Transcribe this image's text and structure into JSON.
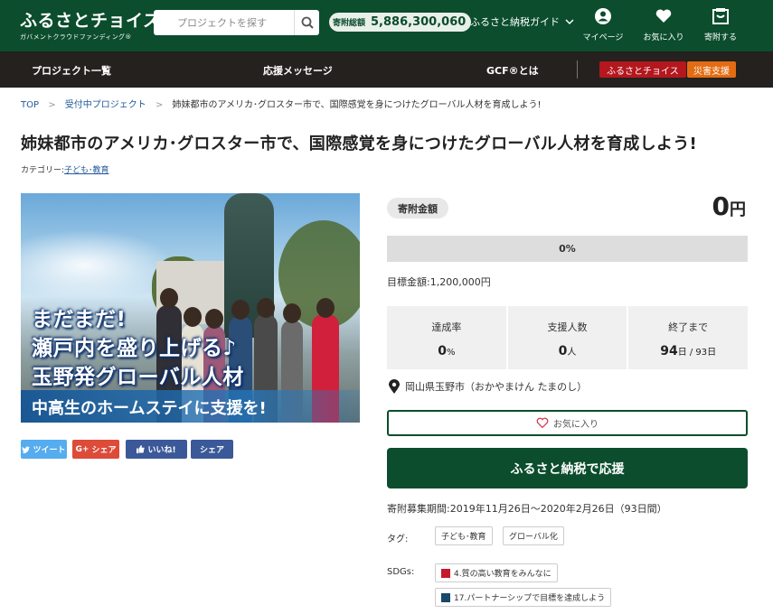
{
  "header": {
    "logo_main": "ふるさとチョイス",
    "logo_sub": "ガバメントクラウドファンディング®",
    "search_placeholder": "プロジェクトを探す",
    "total_label": "寄附総額",
    "total_value": "5,886,300,060",
    "guide_label": "ふるさと納税ガイド",
    "icons": [
      {
        "name": "mypage-icon",
        "label": "マイページ"
      },
      {
        "name": "heart-icon",
        "label": "お気に入り"
      },
      {
        "name": "gift-icon",
        "label": "寄附する"
      }
    ]
  },
  "nav": {
    "items": [
      "プロジェクト一覧",
      "応援メッセージ",
      "GCF®とは"
    ],
    "tag_red": "ふるさとチョイス",
    "tag_orange": "災害支援"
  },
  "breadcrumb": {
    "items": [
      "TOP",
      "受付中プロジェクト"
    ],
    "current": "姉妹都市のアメリカ･グロスター市で、国際感覚を身につけたグローバル人材を育成しよう!"
  },
  "project": {
    "title": "姉妹都市のアメリカ･グロスター市で、国際感覚を身につけたグローバル人材を育成しよう!",
    "category_label": "カテゴリー:",
    "category": "子ども･教育",
    "hero_lines": [
      "まだまだ!",
      "瀬戸内を盛り上げる♪",
      "玉野発グローバル人材"
    ],
    "hero_bottom": "中高生のホームステイに支援を!"
  },
  "share": {
    "tweet": "ツイート",
    "gplus": "シェア",
    "like": "いいね!",
    "share": "シェア"
  },
  "funding": {
    "label": "寄附金額",
    "amount": "0",
    "unit": "円",
    "progress_text": "0%",
    "progress_fraction": 0,
    "goal": "目標金額:1,200,000円",
    "stats": [
      {
        "label": "達成率",
        "value": "0",
        "unit": "%"
      },
      {
        "label": "支援人数",
        "value": "0",
        "unit": "人"
      },
      {
        "label": "終了まで",
        "value": "94",
        "unit": "日 / 93日"
      }
    ],
    "location": "岡山県玉野市（おかやまけん たまのし）",
    "favorite_label": "お気に入り",
    "donate_label": "ふるさと納税で応援",
    "period": "寄附募集期間:2019年11月26日〜2020年2月26日（93日間）"
  },
  "tags": {
    "label": "タグ:",
    "items": [
      "子ども･教育",
      "グローバル化"
    ]
  },
  "sdgs": {
    "label": "SDGs:",
    "items": [
      {
        "text": "4.質の高い教育をみんなに",
        "color": "#c5192d"
      },
      {
        "text": "17.パートナーシップで目標を達成しよう",
        "color": "#19486a"
      }
    ]
  },
  "colors": {
    "brand": "#0b4d2c",
    "nav": "#24211e",
    "twitter": "#55acee",
    "gplus": "#dd4b39",
    "facebook": "#3b5998"
  }
}
